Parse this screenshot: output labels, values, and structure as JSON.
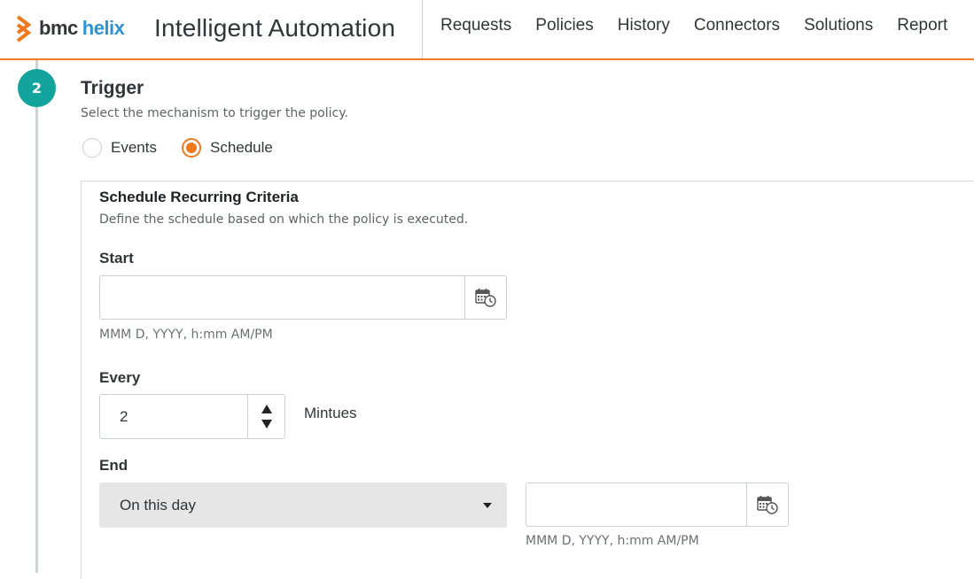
{
  "header": {
    "logo_bmc": "bmc",
    "logo_helix": "helix",
    "app_title": "Intelligent Automation",
    "nav": [
      "Requests",
      "Policies",
      "History",
      "Connectors",
      "Solutions",
      "Report"
    ]
  },
  "colors": {
    "accent": "#f0791d",
    "step": "#13a59d",
    "helix_blue": "#2e93d1"
  },
  "step": {
    "number": "2",
    "title": "Trigger",
    "description": "Select the mechanism to trigger the policy.",
    "options": [
      {
        "label": "Events",
        "checked": false
      },
      {
        "label": "Schedule",
        "checked": true
      }
    ]
  },
  "schedule": {
    "title": "Schedule Recurring Criteria",
    "description": "Define the schedule based on which the policy is executed.",
    "start": {
      "label": "Start",
      "value": "",
      "hint": "MMM D, YYYY, h:mm AM/PM",
      "icon": "calendar-clock-icon"
    },
    "every": {
      "label": "Every",
      "value": "2",
      "unit": "Mintues"
    },
    "end": {
      "label": "End",
      "selected": "On this day",
      "date_value": "",
      "hint": "MMM D, YYYY, h:mm AM/PM",
      "icon": "calendar-clock-icon"
    }
  }
}
